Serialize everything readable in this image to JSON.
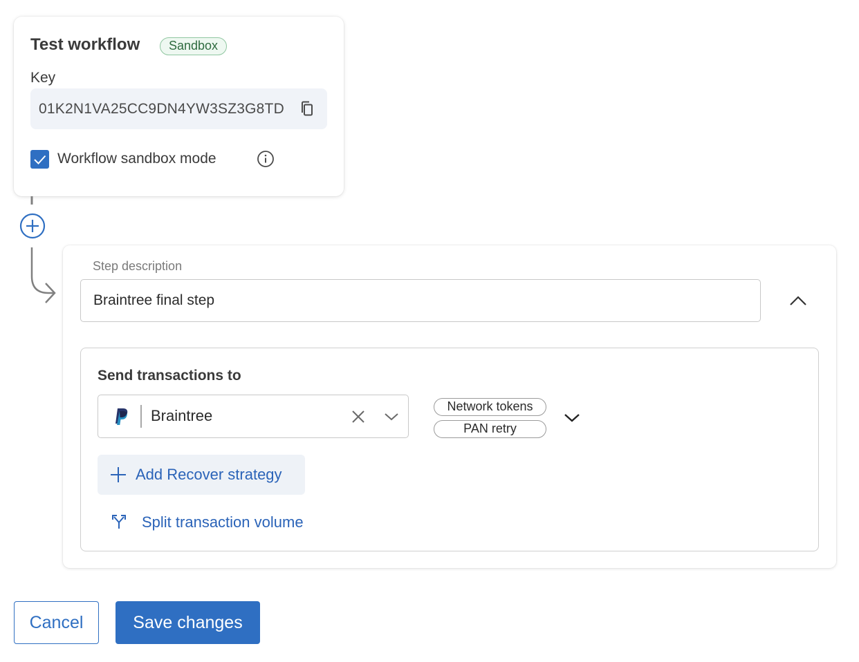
{
  "workflow_card": {
    "title": "Test workflow",
    "badge": "Sandbox",
    "key_label": "Key",
    "key_value": "01K2N1VA25CC9DN4YW3SZ3G8TD",
    "sandbox_checkbox_label": "Workflow sandbox mode",
    "sandbox_checked": true
  },
  "step": {
    "description_label": "Step description",
    "description_value": "Braintree final step",
    "send_label": "Send transactions to",
    "processor": "Braintree",
    "tags": [
      "Network tokens",
      "PAN retry"
    ],
    "add_recover_label": "Add Recover strategy",
    "split_label": "Split transaction volume"
  },
  "footer": {
    "cancel_label": "Cancel",
    "save_label": "Save changes"
  },
  "colors": {
    "accent": "#2f6fc2",
    "link": "#2a63b8",
    "badge_border": "#8fc6a0",
    "badge_bg": "#eef8f1"
  },
  "icons": [
    "copy-icon",
    "checkmark-icon",
    "info-icon",
    "plus-circle-icon",
    "chevron-up-icon",
    "paypal-icon",
    "close-icon",
    "chevron-down-icon",
    "plus-icon",
    "split-icon"
  ]
}
